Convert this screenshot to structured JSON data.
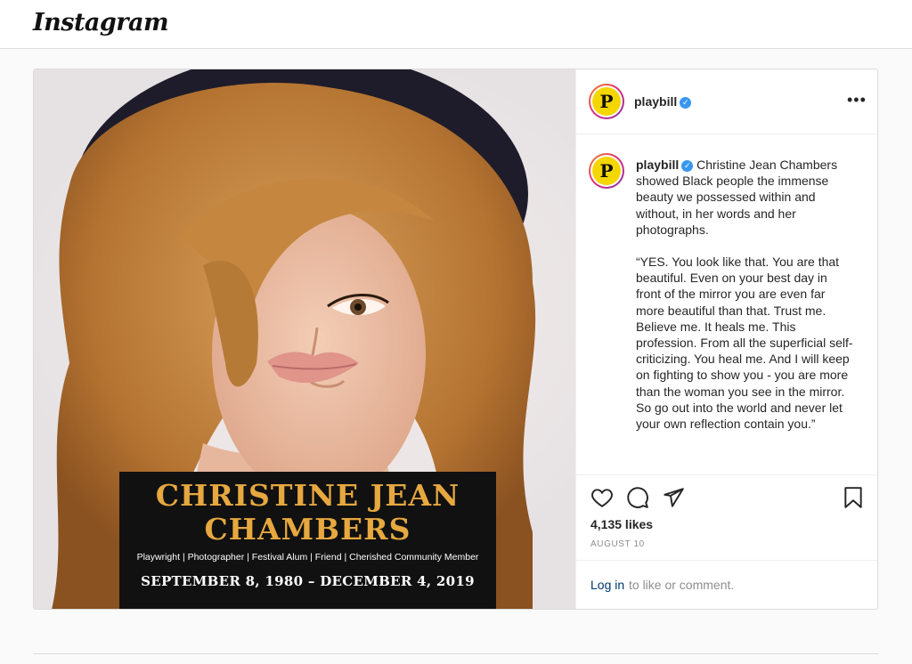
{
  "header": {
    "logo": "Instagram"
  },
  "post": {
    "username": "playbill",
    "avatar_letter": "P",
    "more_label": "•••",
    "image": {
      "banner_name_line1": "CHRISTINE JEAN",
      "banner_name_line2": "CHAMBERS",
      "banner_subtitle": "Playwright | Photographer | Festival Alum | Friend | Cherished Community Member",
      "banner_dates": "SEPTEMBER 8, 1980 – DECEMBER 4, 2019"
    },
    "caption": {
      "paragraph1": "Christine Jean Chambers showed Black people the immense beauty we possessed within and without, in her words and her photographs.",
      "paragraph2": "“YES. You look like that. You are that beautiful. Even on your best day in front of the mirror you are even far more beautiful than that. Trust me. Believe me. It heals me. This profession. From all the superficial self-criticizing. You heal me. And I will keep on fighting to show you - you are more than the woman you see in the mirror. So go out into the world and never let your own reflection contain you.”"
    },
    "likes": "4,135 likes",
    "date": "AUGUST 10",
    "footer": {
      "login_link": "Log in",
      "login_text": "to like or comment."
    },
    "icons": [
      "heart-icon",
      "comment-icon",
      "share-icon",
      "bookmark-icon",
      "verified-icon",
      "more-icon"
    ]
  },
  "colors": {
    "verified": "#3897f0",
    "link": "#00376b",
    "banner_gold": "#e6a83f",
    "avatar_yellow": "#f4d600"
  }
}
